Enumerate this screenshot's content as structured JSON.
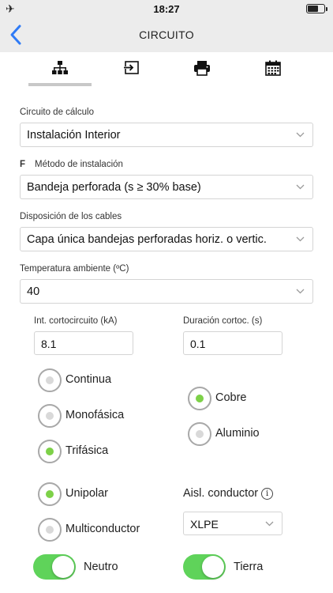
{
  "status_bar": {
    "time": "18:27",
    "airplane_icon": "airplane-icon",
    "battery_icon": "battery-icon"
  },
  "nav": {
    "title": "CIRCUITO",
    "back_icon": "chevron-left-icon"
  },
  "tabs": [
    {
      "icon": "hierarchy-icon",
      "active": true
    },
    {
      "icon": "input-icon",
      "active": false
    },
    {
      "icon": "printer-icon",
      "active": false
    },
    {
      "icon": "calendar-icon",
      "active": false
    }
  ],
  "fields": {
    "circuito_calculo": {
      "label": "Circuito de cálculo",
      "value": "Instalación Interior"
    },
    "metodo_instalacion": {
      "prefix": "F",
      "label": "Método de instalación",
      "value": "Bandeja perforada (s ≥ 30% base)"
    },
    "disposicion_cables": {
      "label": "Disposición de los cables",
      "value": "Capa única bandejas perforadas horiz. o vertic."
    },
    "temperatura": {
      "label": "Temperatura ambiente (ºC)",
      "value": "40"
    }
  },
  "inputs": {
    "int_cortocircuito": {
      "label": "Int. cortocircuito (kA)",
      "value": "8.1"
    },
    "duracion_cortoc": {
      "label": "Duración cortoc. (s)",
      "value": "0.1"
    }
  },
  "radios": {
    "sistema": [
      {
        "label": "Continua",
        "selected": false
      },
      {
        "label": "Monofásica",
        "selected": false
      },
      {
        "label": "Trifásica",
        "selected": true
      }
    ],
    "material": [
      {
        "label": "Cobre",
        "selected": true
      },
      {
        "label": "Aluminio",
        "selected": false
      }
    ],
    "tipo": [
      {
        "label": "Unipolar",
        "selected": true
      },
      {
        "label": "Multiconductor",
        "selected": false
      }
    ]
  },
  "aislamiento": {
    "label": "Aisl. conductor",
    "info_symbol": "i",
    "value": "XLPE"
  },
  "toggles": {
    "neutro": {
      "label": "Neutro",
      "on": true
    },
    "tierra": {
      "label": "Tierra",
      "on": true
    }
  },
  "colors": {
    "accent_blue": "#2f7bf6",
    "radio_selected": "#7dd148",
    "toggle_on": "#5fd35a",
    "bar_bg": "#ececec"
  }
}
